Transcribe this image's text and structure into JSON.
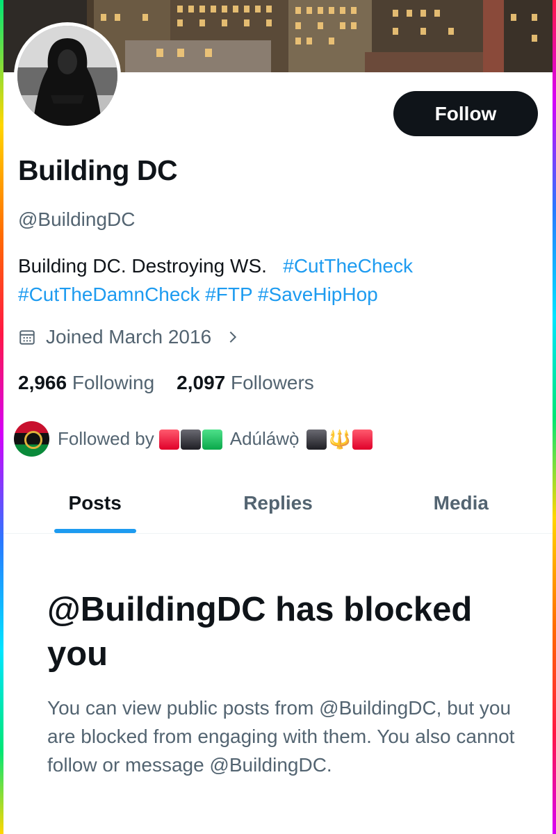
{
  "profile": {
    "name": "Building DC",
    "handle": "@BuildingDC",
    "bio_text": "Building DC. Destroying WS.",
    "bio_tags": [
      "#CutTheCheck",
      "#CutTheDamnCheck",
      "#FTP",
      "#SaveHipHop"
    ],
    "joined": "Joined March 2016",
    "following_count": "2,966",
    "following_label": "Following",
    "followers_count": "2,097",
    "followers_label": "Followers"
  },
  "actions": {
    "follow_label": "Follow"
  },
  "followed_by": {
    "prefix": "Followed by",
    "name": "Adúláwọ̀"
  },
  "tabs": [
    {
      "label": "Posts",
      "active": true
    },
    {
      "label": "Replies",
      "active": false
    },
    {
      "label": "Media",
      "active": false
    }
  ],
  "blocked": {
    "title": "@BuildingDC has blocked you",
    "body": "You can view public posts from @BuildingDC, but you are blocked from engaging with them. You also cannot follow or message @BuildingDC."
  },
  "colors": {
    "accent": "#1d9bf0",
    "text": "#0f1419",
    "secondary": "#536471",
    "button": "#0f1419"
  },
  "icons": {
    "joined": "calendar-icon",
    "joined_more": "chevron-right-icon"
  }
}
